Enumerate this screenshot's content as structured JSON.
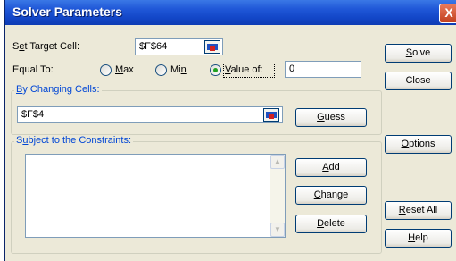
{
  "dialog": {
    "title": "Solver Parameters",
    "close_glyph": "X"
  },
  "target": {
    "label_pre": "S",
    "label_u": "e",
    "label_post": "t Target Cell:",
    "value": "$F$64"
  },
  "equal_to": {
    "label": "Equal To:",
    "options": [
      {
        "pre": "",
        "u": "M",
        "post": "ax",
        "selected": false
      },
      {
        "pre": "Mi",
        "u": "n",
        "post": "",
        "selected": false
      },
      {
        "pre": "",
        "u": "V",
        "post": "alue of:",
        "selected": true
      }
    ],
    "value_of": "0"
  },
  "changing": {
    "title_pre": "",
    "title_u": "B",
    "title_post": "y Changing Cells:",
    "value": "$F$4"
  },
  "constraints": {
    "title_pre": "S",
    "title_u": "u",
    "title_post": "bject to the Constraints:"
  },
  "buttons": {
    "solve": {
      "pre": "",
      "u": "S",
      "post": "olve"
    },
    "close": {
      "pre": "Close",
      "u": "",
      "post": ""
    },
    "guess": {
      "pre": "",
      "u": "G",
      "post": "uess"
    },
    "options": {
      "pre": "",
      "u": "O",
      "post": "ptions"
    },
    "add": {
      "pre": "",
      "u": "A",
      "post": "dd"
    },
    "change": {
      "pre": "",
      "u": "C",
      "post": "hange"
    },
    "delete": {
      "pre": "",
      "u": "D",
      "post": "elete"
    },
    "reset": {
      "pre": "",
      "u": "R",
      "post": "eset All"
    },
    "help": {
      "pre": "",
      "u": "H",
      "post": "elp"
    }
  },
  "icons": {
    "scroll_up": "▲",
    "scroll_down": "▼"
  }
}
